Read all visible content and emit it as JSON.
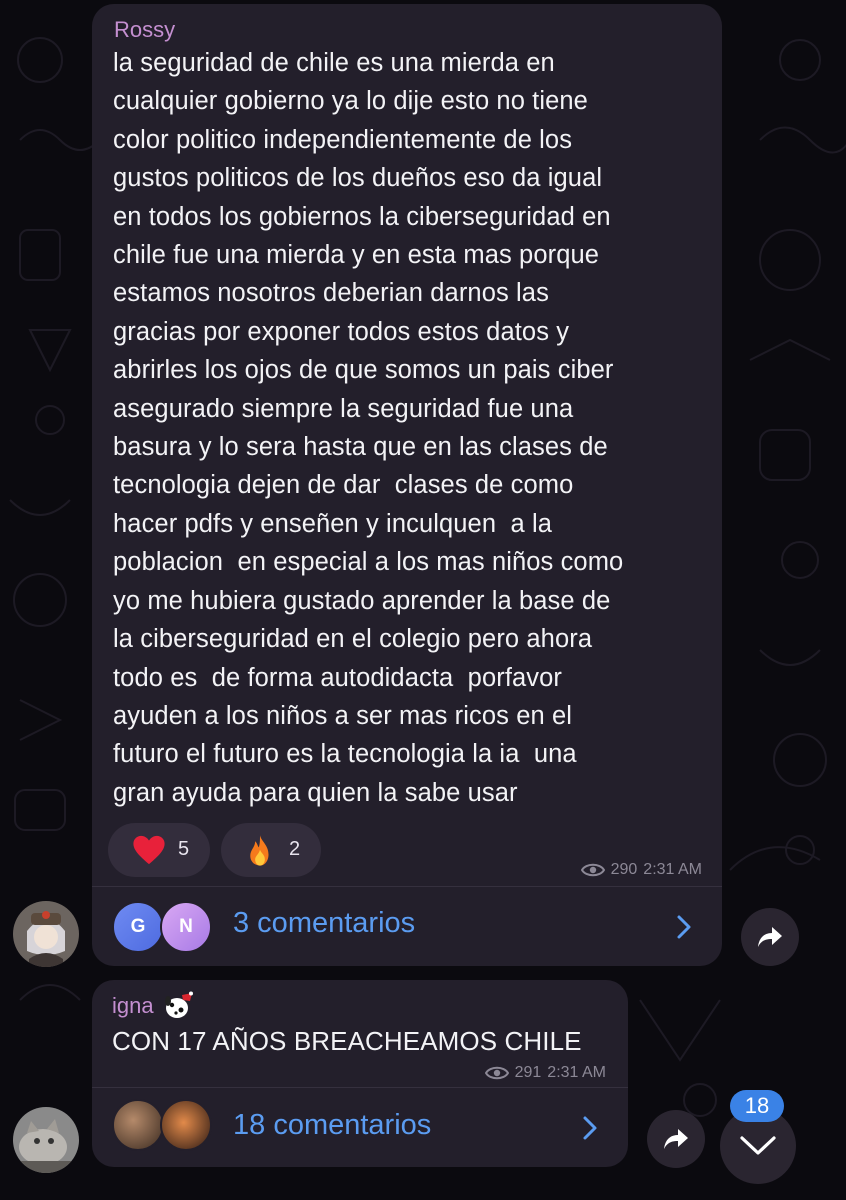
{
  "colors": {
    "background": "#0b0a0f",
    "bubble": "#231f2b",
    "sender_name": "#c48fd0",
    "link_blue": "#5b9cf1",
    "badge_blue": "#3a82e6"
  },
  "post1": {
    "sender": "Rossy",
    "lines": [
      "la seguridad de chile es una mierda en",
      "cualquier gobierno ya lo dije esto no tiene",
      "color politico independientemente de los",
      "gustos politicos de los dueños eso da igual",
      "en todos los gobiernos la ciberseguridad en",
      "chile fue una mierda y en esta mas porque",
      "estamos nosotros deberian darnos las",
      "gracias por exponer todos estos datos y",
      "abrirles los ojos de que somos un pais ciber",
      "asegurado siempre la seguridad fue una",
      "basura y lo sera hasta que en las clases de",
      "tecnologia dejen de dar  clases de como",
      "hacer pdfs y enseñen y inculquen  a la",
      "poblacion  en especial a los mas niños como",
      "yo me hubiera gustado aprender la base de",
      "la ciberseguridad en el colegio pero ahora",
      "todo es  de forma autodidacta  porfavor",
      "ayuden a los niños a ser mas ricos en el",
      "futuro el futuro es la tecnologia la ia  una",
      "gran ayuda para quien la sabe usar"
    ],
    "reactions": [
      {
        "icon": "heart-icon",
        "count": "5"
      },
      {
        "icon": "fire-icon",
        "count": "2"
      }
    ],
    "views": "290",
    "time": "2:31 AM",
    "commenter_initials": [
      "G",
      "N"
    ],
    "comments_label": "3 comentarios"
  },
  "post2": {
    "sender": "igna",
    "text": "CON 17 AÑOS BREACHEAMOS CHILE",
    "views": "291",
    "time": "2:31 AM",
    "comments_label": "18 comentarios"
  },
  "unread_count": "18"
}
